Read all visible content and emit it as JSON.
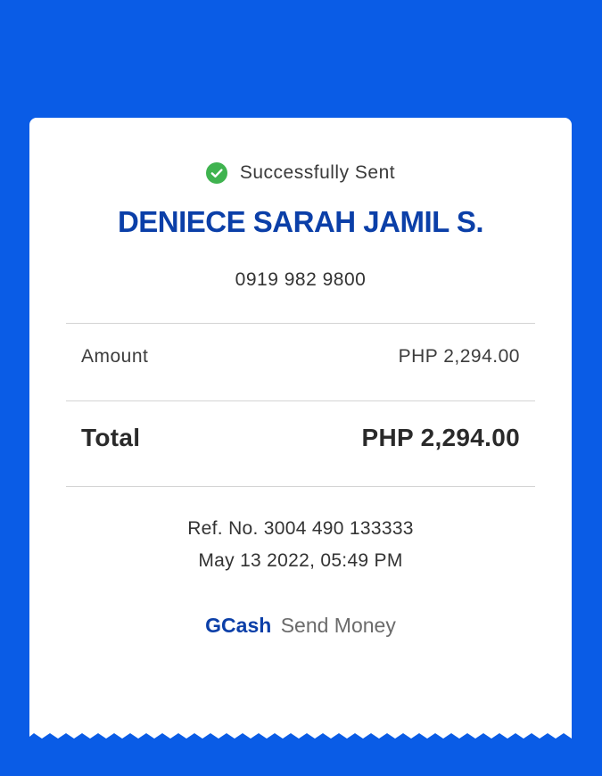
{
  "status": {
    "icon": "check-circle-icon",
    "icon_color": "#3fb34f",
    "text": "Successfully Sent"
  },
  "recipient": {
    "name": "DENIECE SARAH JAMIL S.",
    "phone": "0919 982 9800"
  },
  "amount": {
    "label": "Amount",
    "value": "PHP 2,294.00"
  },
  "total": {
    "label": "Total",
    "value": "PHP 2,294.00"
  },
  "transaction": {
    "reference": "Ref. No. 3004 490 133333",
    "datetime": "May 13 2022, 05:49 PM"
  },
  "footer": {
    "brand": "GCash",
    "service": "Send Money"
  },
  "colors": {
    "background": "#0a5ce6",
    "brand": "#0b3fa8",
    "success": "#3fb34f"
  }
}
